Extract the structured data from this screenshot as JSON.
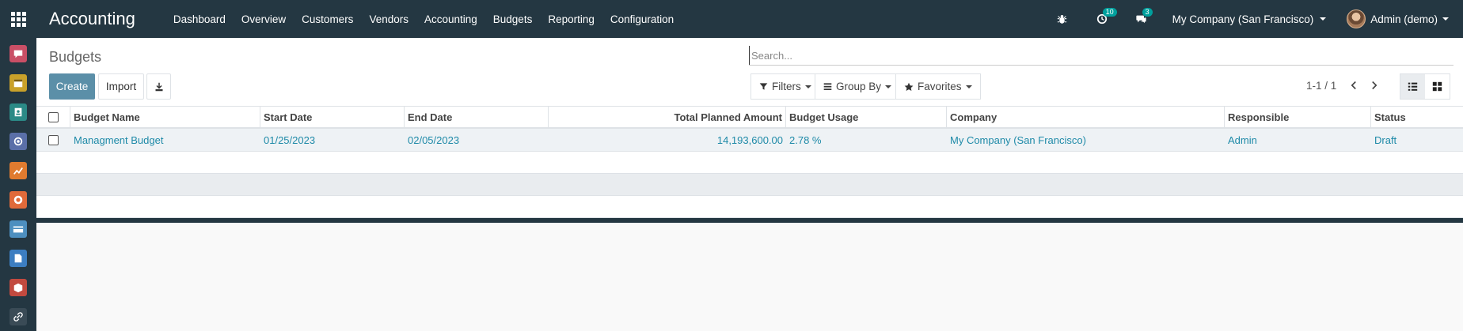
{
  "app": {
    "title": "Accounting"
  },
  "menu": [
    "Dashboard",
    "Overview",
    "Customers",
    "Vendors",
    "Accounting",
    "Budgets",
    "Reporting",
    "Configuration"
  ],
  "systray": {
    "activities_count": "10",
    "messages_count": "3",
    "company": "My Company (San Francisco)",
    "user": "Admin (demo)"
  },
  "colors": {
    "navbar": "#243742",
    "primary": "#5b8fa8",
    "link": "#1e8aa8",
    "badge": "#00a09d"
  },
  "dock_icons": [
    {
      "name": "discuss-icon",
      "color": "#c94f66"
    },
    {
      "name": "calendar-icon",
      "color": "#c9a12a"
    },
    {
      "name": "contacts-icon",
      "color": "#2b8a86"
    },
    {
      "name": "crm-icon",
      "color": "#5a6fa8"
    },
    {
      "name": "sales-icon",
      "color": "#e07b2f"
    },
    {
      "name": "website-icon",
      "color": "#e06a3a"
    },
    {
      "name": "invoicing-icon",
      "color": "#4d8fbf"
    },
    {
      "name": "documents-icon",
      "color": "#3c7ec1"
    },
    {
      "name": "inventory-icon",
      "color": "#c24a3f"
    },
    {
      "name": "link-icon",
      "color": "#3a4b56"
    }
  ],
  "control_panel": {
    "breadcrumb": "Budgets",
    "search_placeholder": "Search...",
    "create_label": "Create",
    "import_label": "Import",
    "filters_label": "Filters",
    "groupby_label": "Group By",
    "favorites_label": "Favorites",
    "pager": "1-1 / 1"
  },
  "table": {
    "columns": [
      "Budget Name",
      "Start Date",
      "End Date",
      "Total Planned Amount",
      "Budget Usage",
      "Company",
      "Responsible",
      "Status"
    ],
    "rows": [
      {
        "name": "Managment Budget",
        "start": "01/25/2023",
        "end": "02/05/2023",
        "total": "14,193,600.00",
        "usage": "2.78 %",
        "company": "My Company (San Francisco)",
        "responsible": "Admin",
        "status": "Draft"
      }
    ]
  }
}
